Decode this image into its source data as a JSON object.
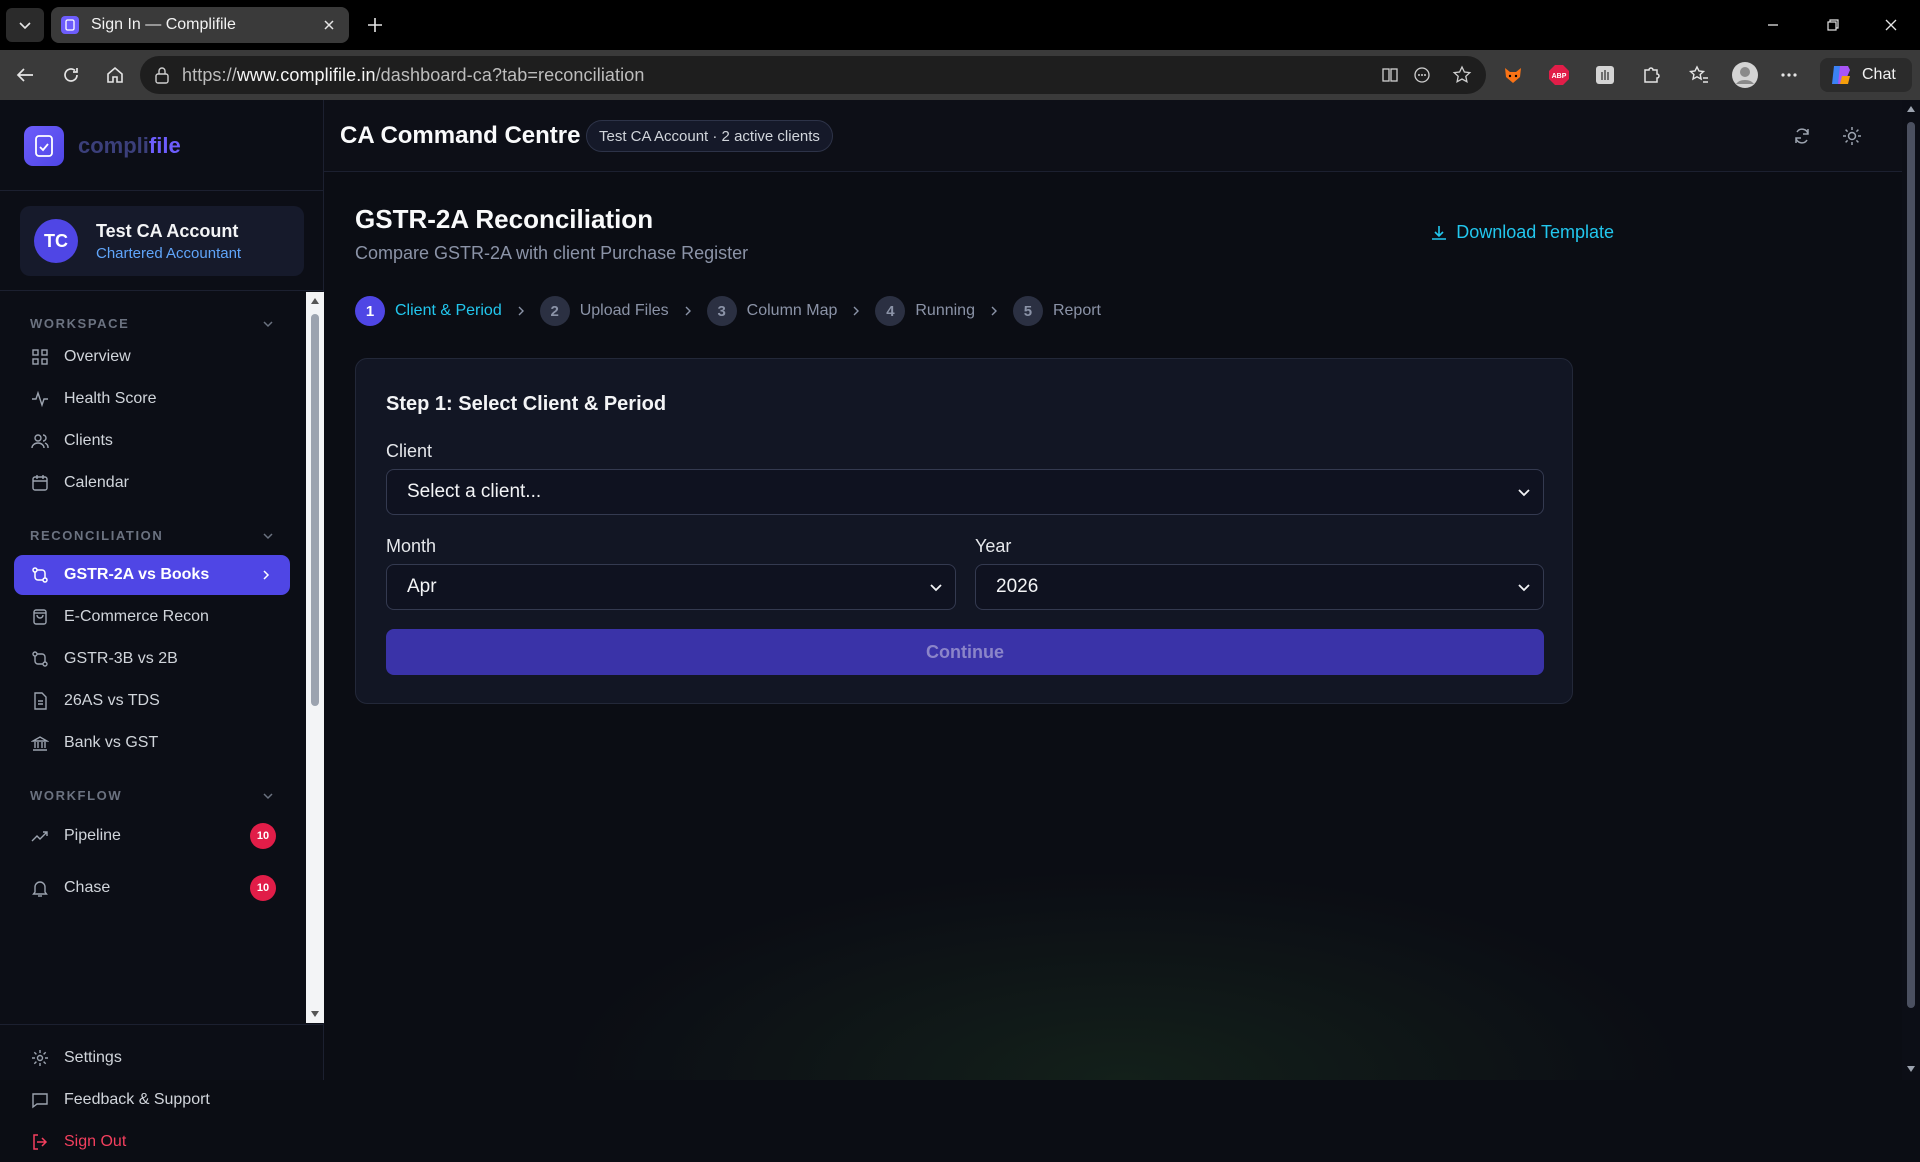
{
  "browser": {
    "tab_title": "Sign In — Complifile",
    "url_prefix": "https://",
    "url_domain": "www.complifile.in",
    "url_path": "/dashboard-ca?tab=reconciliation",
    "chat_label": "Chat",
    "abp_label": "ABP"
  },
  "brand": {
    "name_part1": "compli",
    "name_part2": "file"
  },
  "account": {
    "initials": "TC",
    "name": "Test CA Account",
    "role": "Chartered Accountant"
  },
  "sidebar": {
    "workspace_title": "WORKSPACE",
    "workspace_items": [
      {
        "label": "Overview",
        "icon": "grid-icon"
      },
      {
        "label": "Health Score",
        "icon": "activity-icon"
      },
      {
        "label": "Clients",
        "icon": "users-icon"
      },
      {
        "label": "Calendar",
        "icon": "calendar-icon"
      }
    ],
    "reconciliation_title": "RECONCILIATION",
    "reconciliation_items": [
      {
        "label": "GSTR-2A vs Books",
        "icon": "compare-icon",
        "active": true
      },
      {
        "label": "E-Commerce Recon",
        "icon": "cart-icon"
      },
      {
        "label": "GSTR-3B vs 2B",
        "icon": "compare-icon"
      },
      {
        "label": "26AS vs TDS",
        "icon": "file-icon"
      },
      {
        "label": "Bank vs GST",
        "icon": "bank-icon"
      }
    ],
    "workflow_title": "WORKFLOW",
    "workflow_items": [
      {
        "label": "Pipeline",
        "icon": "trend-icon",
        "badge": "10"
      },
      {
        "label": "Chase",
        "icon": "bell-icon",
        "badge": "10"
      }
    ],
    "footer_items": [
      {
        "label": "Settings",
        "icon": "gear-icon"
      },
      {
        "label": "Feedback & Support",
        "icon": "message-icon"
      },
      {
        "label": "Sign Out",
        "icon": "logout-icon"
      }
    ]
  },
  "header": {
    "title": "CA Command Centre",
    "pill": "Test CA Account · 2 active clients"
  },
  "page": {
    "heading": "GSTR-2A Reconciliation",
    "subheading": "Compare GSTR-2A with client Purchase Register",
    "download_label": "Download Template",
    "steps": [
      {
        "num": "1",
        "label": "Client & Period"
      },
      {
        "num": "2",
        "label": "Upload Files"
      },
      {
        "num": "3",
        "label": "Column Map"
      },
      {
        "num": "4",
        "label": "Running"
      },
      {
        "num": "5",
        "label": "Report"
      }
    ],
    "active_step": 1,
    "card": {
      "title": "Step 1: Select Client & Period",
      "client_label": "Client",
      "client_value": "Select a client...",
      "month_label": "Month",
      "month_value": "Apr",
      "year_label": "Year",
      "year_value": "2026",
      "continue_label": "Continue"
    }
  },
  "colors": {
    "accent": "#4f46e5",
    "cyan": "#22c7ee",
    "badge": "#e11d48",
    "signout": "#f43f5e"
  }
}
